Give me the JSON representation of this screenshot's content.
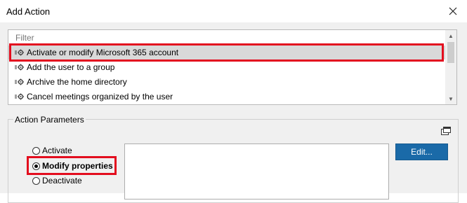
{
  "window": {
    "title": "Add Action",
    "close_icon": "close-icon"
  },
  "list": {
    "filter_placeholder": "Filter",
    "items": [
      {
        "label": "Activate or modify Microsoft 365 account",
        "selected": true,
        "icon": "action-gear-icon"
      },
      {
        "label": "Add the user to a group",
        "selected": false,
        "icon": "action-gear-icon"
      },
      {
        "label": "Archive the home directory",
        "selected": false,
        "icon": "action-gear-icon"
      },
      {
        "label": "Cancel meetings organized by the user",
        "selected": false,
        "icon": "action-gear-icon"
      }
    ]
  },
  "parameters": {
    "group_label": "Action Parameters",
    "options": [
      {
        "label": "Activate",
        "selected": false
      },
      {
        "label": "Modify properties",
        "selected": true
      },
      {
        "label": "Deactivate",
        "selected": false
      }
    ],
    "edit_label": "Edit...",
    "panel_icon": "panel-toggle-icon"
  },
  "colors": {
    "highlight": "#e30d1e",
    "button": "#1a6aa8",
    "selection": "#d9d9d9"
  }
}
